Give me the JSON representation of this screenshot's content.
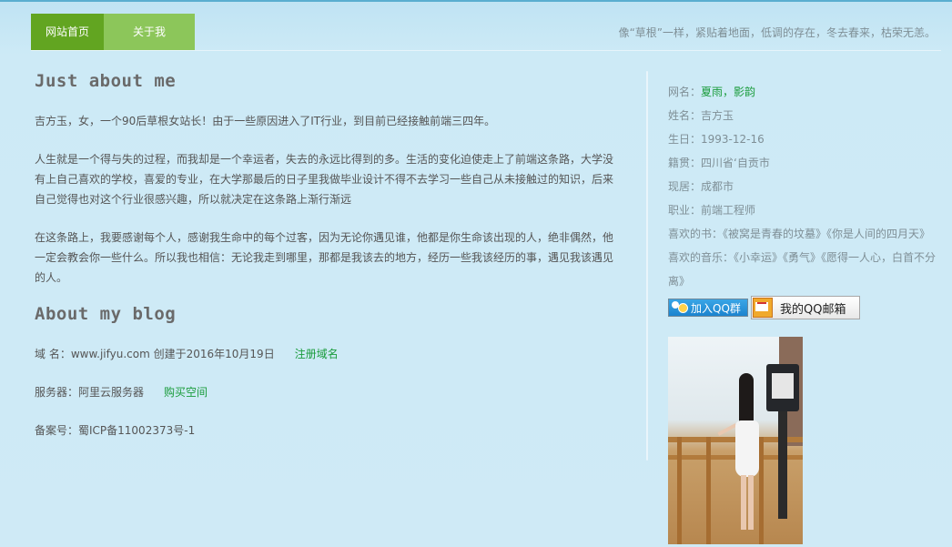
{
  "nav": {
    "home": "网站首页",
    "about": "关于我"
  },
  "motto": "像“草根”一样，紧贴着地面，低调的存在，冬去春来，枯荣无恙。",
  "main": {
    "about_title": "Just about me",
    "para1": "吉方玉，女，一个90后草根女站长！由于一些原因进入了IT行业，到目前已经接触前端三四年。",
    "para2": "人生就是一个得与失的过程，而我却是一个幸运者，失去的永远比得到的多。生活的变化迫使走上了前端这条路，大学没有上自己喜欢的学校，喜爱的专业，在大学那最后的日子里我做毕业设计不得不去学习一些自己从未接触过的知识，后来自己觉得也对这个行业很感兴趣，所以就决定在这条路上渐行渐远",
    "para3": "在这条路上，我要感谢每个人，感谢我生命中的每个过客，因为无论你遇见谁，他都是你生命该出现的人，绝非偶然，他一定会教会你一些什么。所以我也相信：无论我走到哪里，那都是我该去的地方，经历一些我该经历的事，遇见我该遇见的人。",
    "blog_title": "About my blog",
    "domain_text": "域 名：www.jifyu.com 创建于2016年10月19日",
    "domain_link": "注册域名",
    "server_text": "服务器：阿里云服务器",
    "server_link": "购买空间",
    "icp_text": "备案号：蜀ICP备11002373号-1"
  },
  "profile": {
    "nickname_label": "网名：",
    "nickname_value": "夏雨，影韵",
    "name_label": "姓名：",
    "name_value": "吉方玉",
    "birthday_label": "生日：",
    "birthday_value": "1993-12-16",
    "origin_label": "籍贯：",
    "origin_value": "四川省‘自贡市",
    "residence_label": "现居：",
    "residence_value": "成都市",
    "job_label": "职业：",
    "job_value": "前端工程师",
    "books_label": "喜欢的书：",
    "books_value": "《被窝是青春的坟墓》《你是人间的四月天》",
    "music_label": "喜欢的音乐：",
    "music_value": "《小幸运》《勇气》《愿得一人心，白首不分离》",
    "qq_group_button": "加入QQ群",
    "qq_mail_button": "我的QQ邮箱"
  }
}
